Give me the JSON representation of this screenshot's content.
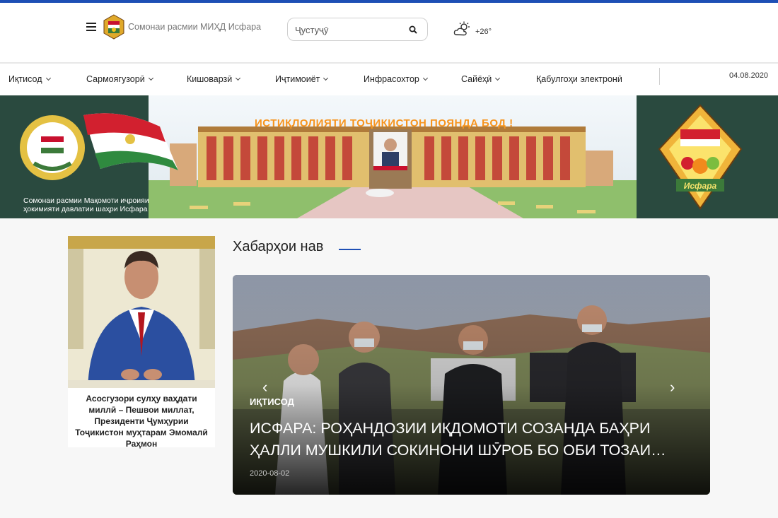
{
  "header": {
    "site_name": "Сомонаи расмии МИҲД Исфара",
    "search_placeholder": "Ҷустуҷӯ",
    "weather_temp": "+26°"
  },
  "nav": {
    "items": [
      {
        "label": "Иқтисод"
      },
      {
        "label": "Сармоягузорӣ"
      },
      {
        "label": "Кишоварзӣ"
      },
      {
        "label": "Иҷтимоиёт"
      },
      {
        "label": "Инфрасохтор"
      },
      {
        "label": "Сайёҳӣ"
      },
      {
        "label": "Қабулгоҳи электронӣ"
      }
    ],
    "date": "04.08.2020"
  },
  "banner": {
    "caption": "Сомонаи расмии Мақомоти иҷроияи ҳокимияти давлатии шаҳри Исфара",
    "headline": "ИСТИҚЛОЛИЯТИ ТОҶИКИСТОН ПОЯНДА БОД !",
    "logo_text": "Исфара"
  },
  "president_card": {
    "caption": "Асосгузори сулҳу ваҳдати миллӣ – Пешвои миллат, Президенти Ҷумҳурии Тоҷикистон муҳтарам Эмомалӣ Раҳмон"
  },
  "news": {
    "section_title": "Хабарҳои нав",
    "slide": {
      "category": "ИҚТИСОД",
      "title": "ИСФАРА: РОҲАНДОЗИИ ИҚДОМОТИ СОЗАНДА БАҲРИ ҲАЛЛИ МУШКИЛИ СОКИНОНИ ШӮРОБ БО ОБИ ТОЗАИ…",
      "date": "2020-08-02"
    }
  },
  "colors": {
    "accent": "#1e4fb5",
    "banner_bg": "#2a4a3f",
    "headline": "#f7941d"
  }
}
